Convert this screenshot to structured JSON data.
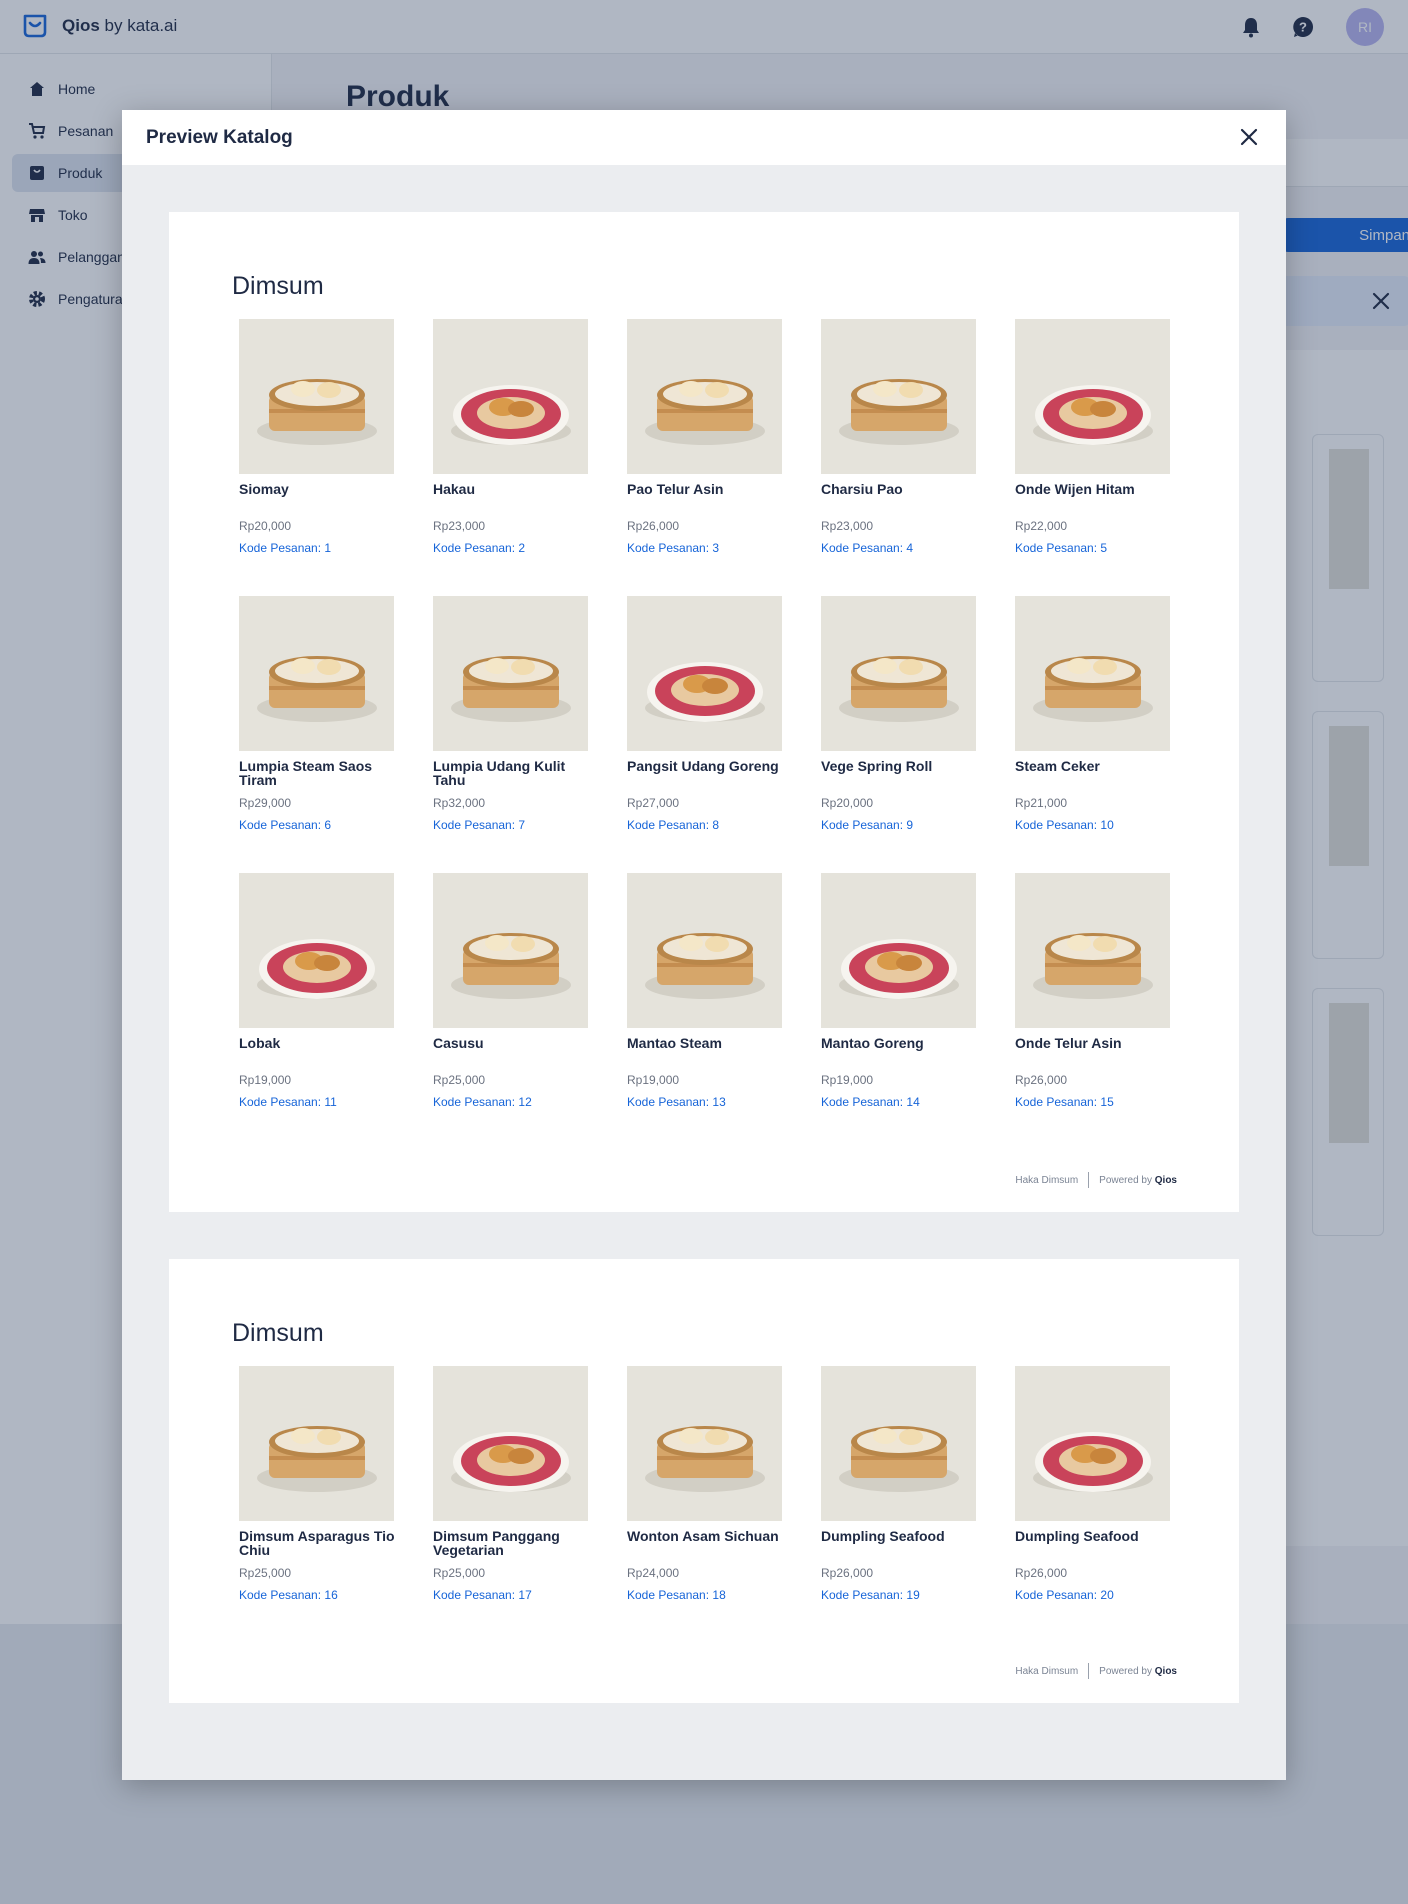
{
  "brand": {
    "name": "Qios",
    "suffix": " by kata.ai"
  },
  "user": {
    "initials": "RI"
  },
  "sidebar": {
    "items": [
      {
        "label": "Home",
        "icon": "home-icon"
      },
      {
        "label": "Pesanan",
        "icon": "cart-icon"
      },
      {
        "label": "Produk",
        "icon": "product-icon",
        "active": true
      },
      {
        "label": "Toko",
        "icon": "store-icon"
      },
      {
        "label": "Pelanggan",
        "icon": "users-icon"
      },
      {
        "label": "Pengaturan",
        "icon": "gear-icon"
      }
    ]
  },
  "main": {
    "page_title": "Produk",
    "save_label": "Simpan"
  },
  "modal": {
    "title": "Preview Katalog",
    "pages": [
      {
        "section_title": "Dimsum",
        "footer_store": "Haka Dimsum",
        "footer_powered": "Powered by",
        "footer_brand": "Qios",
        "products": [
          {
            "name": "Siomay",
            "price": "Rp20,000",
            "code": "Kode Pesanan: 1"
          },
          {
            "name": "Hakau",
            "price": "Rp23,000",
            "code": "Kode Pesanan: 2"
          },
          {
            "name": "Pao Telur Asin",
            "price": "Rp26,000",
            "code": "Kode Pesanan: 3"
          },
          {
            "name": "Charsiu Pao",
            "price": "Rp23,000",
            "code": "Kode Pesanan: 4"
          },
          {
            "name": "Onde Wijen Hitam",
            "price": "Rp22,000",
            "code": "Kode Pesanan: 5"
          },
          {
            "name": "Lumpia Steam Saos Tiram",
            "price": "Rp29,000",
            "code": "Kode Pesanan: 6"
          },
          {
            "name": "Lumpia Udang Kulit Tahu",
            "price": "Rp32,000",
            "code": "Kode Pesanan: 7"
          },
          {
            "name": "Pangsit Udang Goreng",
            "price": "Rp27,000",
            "code": "Kode Pesanan: 8"
          },
          {
            "name": "Vege Spring Roll",
            "price": "Rp20,000",
            "code": "Kode Pesanan: 9"
          },
          {
            "name": "Steam Ceker",
            "price": "Rp21,000",
            "code": "Kode Pesanan: 10"
          },
          {
            "name": "Lobak",
            "price": "Rp19,000",
            "code": "Kode Pesanan: 11"
          },
          {
            "name": "Casusu",
            "price": "Rp25,000",
            "code": "Kode Pesanan: 12"
          },
          {
            "name": "Mantao Steam",
            "price": "Rp19,000",
            "code": "Kode Pesanan: 13"
          },
          {
            "name": "Mantao Goreng",
            "price": "Rp19,000",
            "code": "Kode Pesanan: 14"
          },
          {
            "name": "Onde Telur Asin",
            "price": "Rp26,000",
            "code": "Kode Pesanan: 15"
          }
        ]
      },
      {
        "section_title": "Dimsum",
        "footer_store": "Haka Dimsum",
        "footer_powered": "Powered by",
        "footer_brand": "Qios",
        "products": [
          {
            "name": "Dimsum Asparagus Tio Chiu",
            "price": "Rp25,000",
            "code": "Kode Pesanan: 16"
          },
          {
            "name": "Dimsum Panggang Vegetarian",
            "price": "Rp25,000",
            "code": "Kode Pesanan: 17"
          },
          {
            "name": "Wonton Asam Sichuan",
            "price": "Rp24,000",
            "code": "Kode Pesanan: 18"
          },
          {
            "name": "Dumpling Seafood",
            "price": "Rp26,000",
            "code": "Kode Pesanan: 19"
          },
          {
            "name": "Dumpling Seafood",
            "price": "Rp26,000",
            "code": "Kode Pesanan: 20"
          }
        ]
      }
    ]
  },
  "colors": {
    "accent": "#1664d8",
    "text": "#1f2a44",
    "overlay": "#24385a"
  }
}
